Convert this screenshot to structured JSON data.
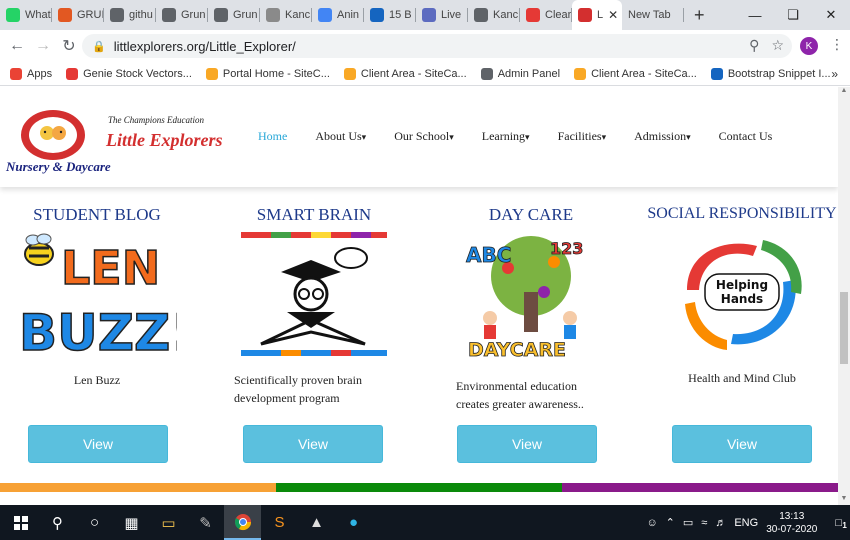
{
  "browser": {
    "tabs": [
      {
        "label": "What",
        "icon": "whatsapp-icon",
        "color": "#25d366"
      },
      {
        "label": "GRUI",
        "icon": "grid-icon",
        "color": "#e25822"
      },
      {
        "label": "githu",
        "icon": "globe-icon",
        "color": "#5f6368"
      },
      {
        "label": "Grun",
        "icon": "globe-icon",
        "color": "#5f6368"
      },
      {
        "label": "Grun",
        "icon": "globe-icon",
        "color": "#5f6368"
      },
      {
        "label": "Kanc",
        "icon": "doc-icon",
        "color": "#8a8a8a"
      },
      {
        "label": "Anin",
        "icon": "google-icon",
        "color": "#4285f4"
      },
      {
        "label": "15 B",
        "icon": "bootstrap-icon",
        "color": "#1565c0"
      },
      {
        "label": "Live",
        "icon": "live-icon",
        "color": "#5c6bc0"
      },
      {
        "label": "Kanc",
        "icon": "globe-icon",
        "color": "#5f6368"
      },
      {
        "label": "Clear",
        "icon": "clear-icon",
        "color": "#e53935"
      },
      {
        "label": "L",
        "icon": "little-explorers-icon",
        "color": "#d32f2f"
      },
      {
        "label": "New Tab",
        "icon": "",
        "color": ""
      }
    ],
    "url": "littlexplorers.org/Little_Explorer/",
    "profile_initial": "K"
  },
  "bookmarks": [
    {
      "label": "Apps",
      "icon": "apps-grid-icon",
      "color": "#ea4335"
    },
    {
      "label": "Genie Stock Vectors...",
      "icon": "genie-icon",
      "color": "#e53935"
    },
    {
      "label": "Portal Home - SiteC...",
      "icon": "sitecare-icon",
      "color": "#f9a825"
    },
    {
      "label": "Client Area - SiteCa...",
      "icon": "sitecare-icon",
      "color": "#f9a825"
    },
    {
      "label": "Admin Panel",
      "icon": "globe-icon",
      "color": "#5f6368"
    },
    {
      "label": "Client Area - SiteCa...",
      "icon": "sitecare-icon",
      "color": "#f9a825"
    },
    {
      "label": "Bootstrap Snippet I...",
      "icon": "bootstrap-icon",
      "color": "#1565c0"
    }
  ],
  "bookmarks_more": "»",
  "site": {
    "tagline": "The Champions Education",
    "name": "Little Explorers",
    "subtitle": "Nursery & Daycare",
    "menu": [
      "Home",
      "About Us",
      "Our School",
      "Learning",
      "Facilities",
      "Admission",
      "Contact Us"
    ],
    "menu_dropdown": [
      false,
      true,
      true,
      true,
      true,
      true,
      false
    ]
  },
  "cards": [
    {
      "title": "STUDENT BLOG",
      "desc": "Len Buzz",
      "button": "View",
      "image_text": [
        "LEN",
        "BUZZ!"
      ]
    },
    {
      "title": "SMART BRAIN",
      "desc": "Scientifically proven brain development program",
      "button": "View"
    },
    {
      "title": "DAY CARE",
      "desc": "Environmental education creates greater awareness..",
      "button": "View",
      "image_text": [
        "ABC",
        "123",
        "DAYCARE"
      ]
    },
    {
      "title": "SOCIAL RESPONSIBILITY",
      "desc": "Health and Mind Club",
      "button": "View",
      "image_text": [
        "Helping",
        "Hands"
      ]
    }
  ],
  "stripe_colors": [
    "#f7a135",
    "#0a8a0a",
    "#8a1a8a"
  ],
  "taskbar": {
    "time": "13:13",
    "date": "30-07-2020",
    "lang": "ENG",
    "notifications": "1"
  }
}
